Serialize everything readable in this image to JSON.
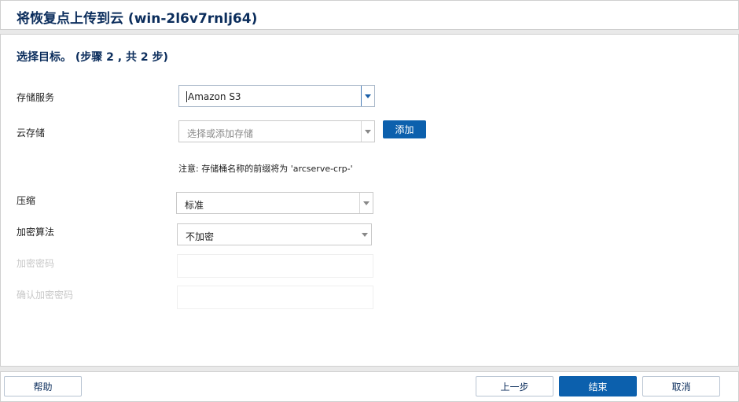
{
  "dialog": {
    "title": "将恢复点上传到云 (win-2l6v7rnlj64)"
  },
  "step": {
    "heading": "选择目标。 (步骤 2 , 共 2 步)"
  },
  "form": {
    "storage_service": {
      "label": "存储服务",
      "value": "Amazon S3"
    },
    "cloud_storage": {
      "label": "云存储",
      "placeholder": "选择或添加存储",
      "add_label": "添加"
    },
    "note": "注意: 存储桶名称的前缀将为 'arcserve-crp-'",
    "compression": {
      "label": "压缩",
      "value": "标准"
    },
    "encryption_algorithm": {
      "label": "加密算法",
      "value": "不加密"
    },
    "encryption_password": {
      "label": "加密密码"
    },
    "confirm_password": {
      "label": "确认加密密码"
    }
  },
  "footer": {
    "help": "帮助",
    "previous": "上一步",
    "finish": "结束",
    "cancel": "取消"
  },
  "colors": {
    "accent": "#0c60ad",
    "title": "#0b2d5c"
  }
}
